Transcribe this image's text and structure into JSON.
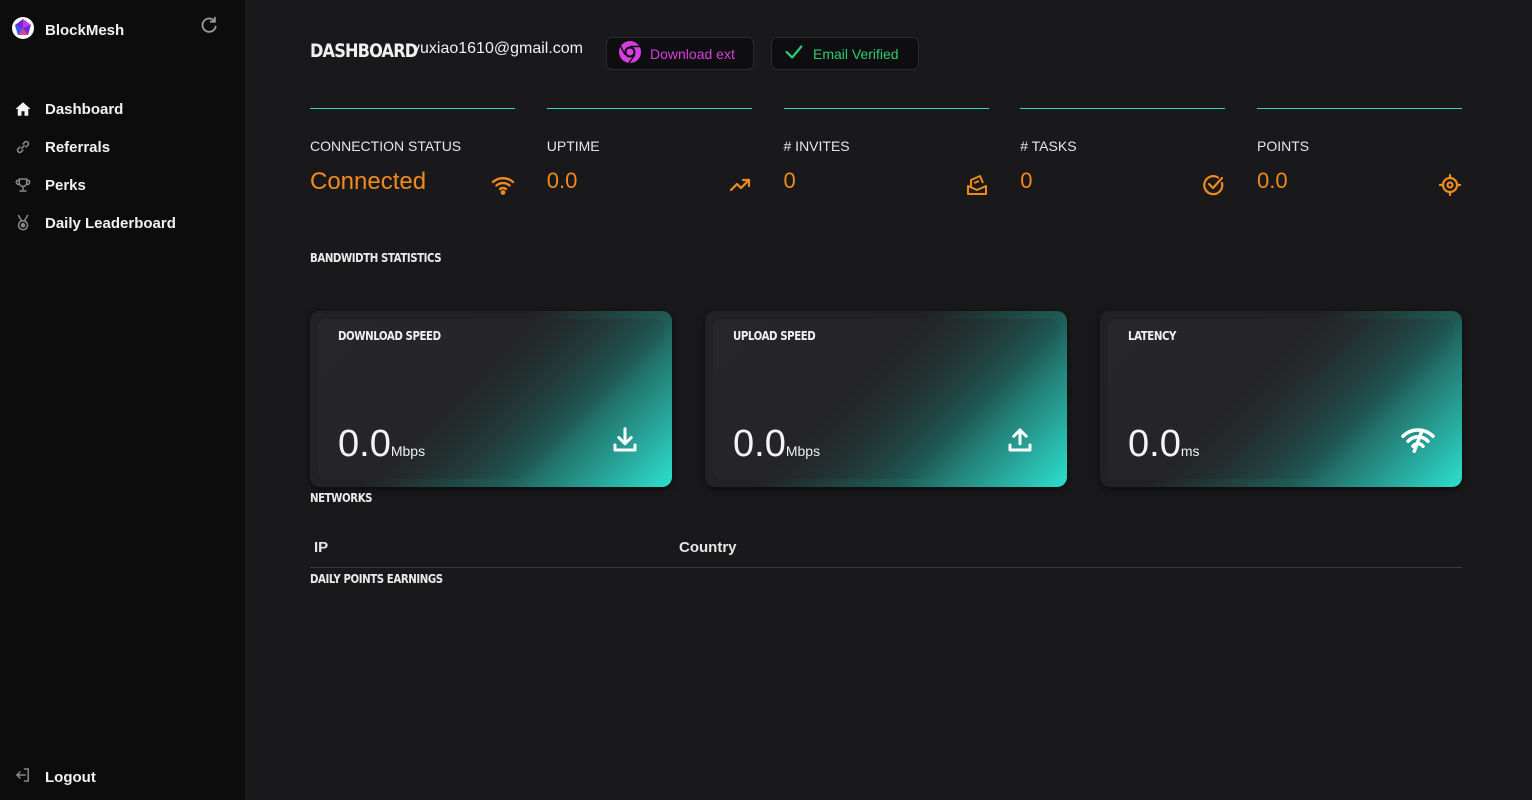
{
  "app": {
    "name": "BlockMesh"
  },
  "sidebar": {
    "items": [
      {
        "label": "Dashboard",
        "icon": "home-icon"
      },
      {
        "label": "Referrals",
        "icon": "link-icon"
      },
      {
        "label": "Perks",
        "icon": "trophy-icon"
      },
      {
        "label": "Daily Leaderboard",
        "icon": "medal-icon"
      }
    ],
    "logout_label": "Logout"
  },
  "header": {
    "title": "DASHBOARD",
    "email": "yuxiao1610@gmail.com",
    "download_label": "Download ext",
    "verified_label": "Email Verified"
  },
  "stats": [
    {
      "label": "CONNECTION STATUS",
      "value": "Connected",
      "icon": "wifi-icon"
    },
    {
      "label": "UPTIME",
      "value": "0.0",
      "icon": "trending-up-icon"
    },
    {
      "label": "# INVITES",
      "value": "0",
      "icon": "invites-icon"
    },
    {
      "label": "# TASKS",
      "value": "0",
      "icon": "check-circle-icon"
    },
    {
      "label": "POINTS",
      "value": "0.0",
      "icon": "target-icon"
    }
  ],
  "bandwidth": {
    "title": "BANDWIDTH STATISTICS",
    "cards": [
      {
        "title": "DOWNLOAD SPEED",
        "value": "0.0",
        "unit": "Mbps",
        "icon": "download-icon"
      },
      {
        "title": "UPLOAD SPEED",
        "value": "0.0",
        "unit": "Mbps",
        "icon": "upload-icon"
      },
      {
        "title": "LATENCY",
        "value": "0.0",
        "unit": "ms",
        "icon": "signal-latency-icon"
      }
    ]
  },
  "networks": {
    "title": "NETWORKS",
    "columns": [
      "IP",
      "Country"
    ]
  },
  "daily_points": {
    "title": "DAILY POINTS EARNINGS"
  },
  "colors": {
    "accent": "#f08a1c",
    "teal": "#2ee0cf",
    "magenta": "#d63ee0",
    "green": "#2ecc71"
  }
}
